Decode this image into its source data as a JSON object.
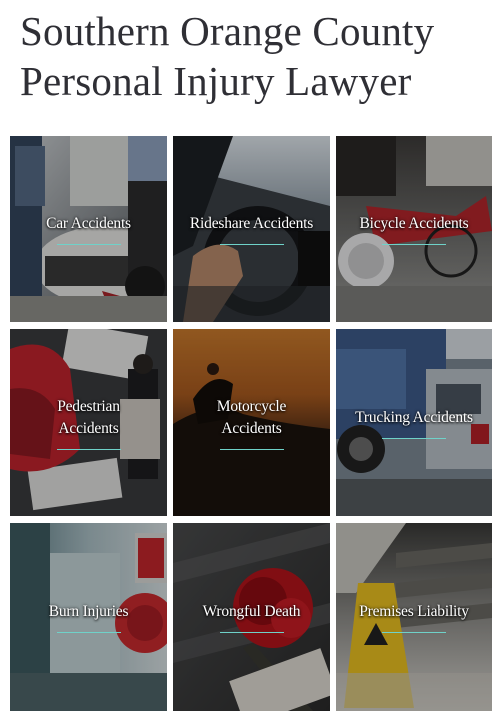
{
  "header": {
    "title_line1": "Southern Orange County",
    "title_line2": "Personal Injury Lawyer"
  },
  "practice_areas": [
    {
      "label": "Car Accidents",
      "label_lines": [
        "Car Accidents"
      ],
      "image": "car-accident-photo"
    },
    {
      "label": "Rideshare Accidents",
      "label_lines": [
        "Rideshare Accidents"
      ],
      "image": "rideshare-driver-photo"
    },
    {
      "label": "Bicycle Accidents",
      "label_lines": [
        "Bicycle Accidents"
      ],
      "image": "bicycle-accident-photo"
    },
    {
      "label": "Pedestrian Accidents",
      "label_lines": [
        "Pedestrian",
        "Accidents"
      ],
      "image": "pedestrian-crosswalk-photo"
    },
    {
      "label": "Motorcycle Accidents",
      "label_lines": [
        "Motorcycle",
        "Accidents"
      ],
      "image": "motorcycle-sunset-photo"
    },
    {
      "label": "Trucking Accidents",
      "label_lines": [
        "Trucking Accidents"
      ],
      "image": "truck-collision-photo"
    },
    {
      "label": "Burn Injuries",
      "label_lines": [
        "Burn Injuries"
      ],
      "image": "fire-alarm-photo"
    },
    {
      "label": "Wrongful Death",
      "label_lines": [
        "Wrongful Death"
      ],
      "image": "red-rose-photo"
    },
    {
      "label": "Premises Liability",
      "label_lines": [
        "Premises Liability"
      ],
      "image": "wet-floor-sign-photo"
    }
  ],
  "colors": {
    "title": "#2f2f35",
    "underline_accent": "#6fd2c9",
    "label_text": "#ffffff"
  }
}
